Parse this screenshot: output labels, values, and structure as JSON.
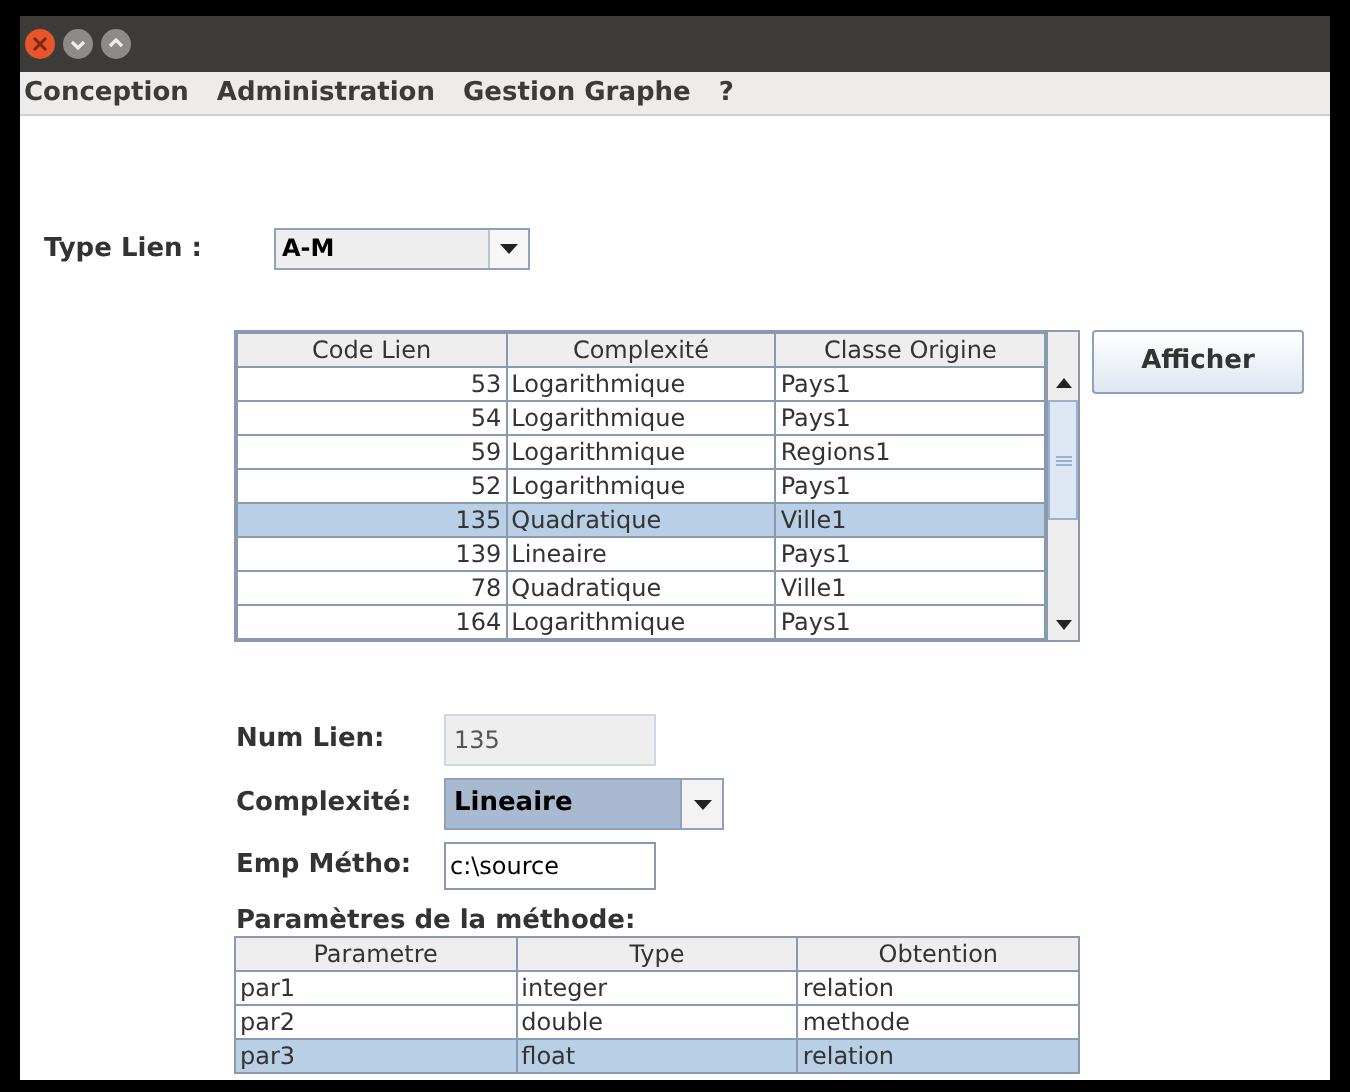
{
  "window": {
    "buttons": [
      {
        "kind": "close"
      },
      {
        "kind": "minimize"
      },
      {
        "kind": "maximize"
      }
    ]
  },
  "menu": [
    "Conception",
    "Administration",
    "Gestion Graphe",
    "?"
  ],
  "type_lien": {
    "label": "Type Lien :",
    "value": "A-M"
  },
  "links_table": {
    "columns": [
      "Code Lien",
      "Complexité",
      "Classe Origine"
    ],
    "rows": [
      {
        "cells": [
          "53",
          "Logarithmique",
          "Pays1"
        ],
        "selected": false
      },
      {
        "cells": [
          "54",
          "Logarithmique",
          "Pays1"
        ],
        "selected": false
      },
      {
        "cells": [
          "59",
          "Logarithmique",
          "Regions1"
        ],
        "selected": false
      },
      {
        "cells": [
          "52",
          "Logarithmique",
          "Pays1"
        ],
        "selected": false
      },
      {
        "cells": [
          "135",
          "Quadratique",
          "Ville1"
        ],
        "selected": true
      },
      {
        "cells": [
          "139",
          "Lineaire",
          "Pays1"
        ],
        "selected": false
      },
      {
        "cells": [
          "78",
          "Quadratique",
          "Ville1"
        ],
        "selected": false
      },
      {
        "cells": [
          "164",
          "Logarithmique",
          "Pays1"
        ],
        "selected": false
      }
    ]
  },
  "afficher_button": "Afficher",
  "num_lien": {
    "label": "Num Lien:",
    "value": "135",
    "disabled": true
  },
  "complexite": {
    "label": "Complexité:",
    "value": "Lineaire"
  },
  "emp_metho": {
    "label": "Emp Métho:",
    "value": "c:\\source"
  },
  "params": {
    "title": "Paramètres de la méthode:",
    "columns": [
      "Parametre",
      "Type",
      "Obtention"
    ],
    "rows": [
      {
        "cells": [
          "par1",
          "integer",
          "relation"
        ],
        "selected": false
      },
      {
        "cells": [
          "par2",
          "double",
          "methode"
        ],
        "selected": false
      },
      {
        "cells": [
          "par3",
          "float",
          "relation"
        ],
        "selected": true
      }
    ]
  }
}
